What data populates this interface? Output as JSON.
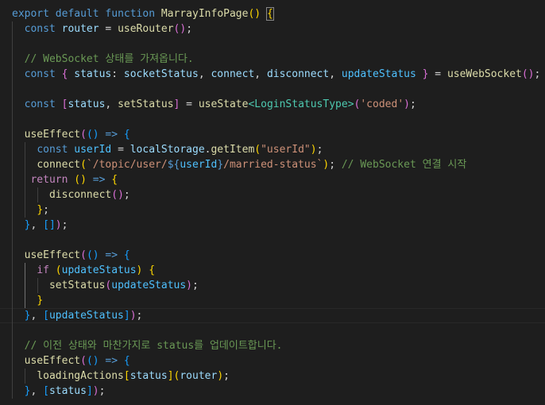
{
  "editor": {
    "language": "typescript",
    "theme_colors": {
      "background": "#1e1e1e",
      "keyword": "#569cd6",
      "control": "#c586c0",
      "function": "#dcdcaa",
      "variable": "#9cdcfe",
      "string": "#ce9178",
      "type": "#4ec9b0",
      "comment": "#6a9955",
      "bracket_1": "#ffd700",
      "bracket_2": "#da70d6",
      "bracket_3": "#179fff"
    },
    "lines": [
      [
        [
          "kw",
          "export"
        ],
        [
          "p",
          " "
        ],
        [
          "kw",
          "default"
        ],
        [
          "p",
          " "
        ],
        [
          "kw",
          "function"
        ],
        [
          "p",
          " "
        ],
        [
          "fn",
          "MarrayInfoPage"
        ],
        [
          "b1",
          "()"
        ],
        [
          "p",
          " "
        ],
        [
          "b1",
          "{"
        ]
      ],
      [
        [
          "p",
          "  "
        ],
        [
          "kw",
          "const"
        ],
        [
          "p",
          " "
        ],
        [
          "var",
          "router"
        ],
        [
          "p",
          " = "
        ],
        [
          "fn",
          "useRouter"
        ],
        [
          "b2",
          "()"
        ],
        [
          "p",
          ";"
        ]
      ],
      [],
      [
        [
          "p",
          "  "
        ],
        [
          "cm",
          "// WebSocket 상태를 가져옵니다."
        ]
      ],
      [
        [
          "p",
          "  "
        ],
        [
          "kw",
          "const"
        ],
        [
          "p",
          " "
        ],
        [
          "b2",
          "{"
        ],
        [
          "p",
          " "
        ],
        [
          "var",
          "status"
        ],
        [
          "p",
          ": "
        ],
        [
          "var",
          "socketStatus"
        ],
        [
          "p",
          ", "
        ],
        [
          "var",
          "connect"
        ],
        [
          "p",
          ", "
        ],
        [
          "var",
          "disconnect"
        ],
        [
          "p",
          ", "
        ],
        [
          "const",
          "updateStatus"
        ],
        [
          "p",
          " "
        ],
        [
          "b2",
          "}"
        ],
        [
          "p",
          " = "
        ],
        [
          "fn",
          "useWebSocket"
        ],
        [
          "b2",
          "()"
        ],
        [
          "p",
          ";"
        ]
      ],
      [],
      [
        [
          "p",
          "  "
        ],
        [
          "kw",
          "const"
        ],
        [
          "p",
          " "
        ],
        [
          "b2",
          "["
        ],
        [
          "var",
          "status"
        ],
        [
          "p",
          ", "
        ],
        [
          "fn",
          "setStatus"
        ],
        [
          "b2",
          "]"
        ],
        [
          "p",
          " = "
        ],
        [
          "fn",
          "useState"
        ],
        [
          "type",
          "<LoginStatusType>"
        ],
        [
          "b2",
          "("
        ],
        [
          "str",
          "'coded'"
        ],
        [
          "b2",
          ")"
        ],
        [
          "p",
          ";"
        ]
      ],
      [],
      [
        [
          "p",
          "  "
        ],
        [
          "fn",
          "useEffect"
        ],
        [
          "b2",
          "("
        ],
        [
          "b3",
          "()"
        ],
        [
          "p",
          " "
        ],
        [
          "kw",
          "=>"
        ],
        [
          "p",
          " "
        ],
        [
          "b3",
          "{"
        ]
      ],
      [
        [
          "p",
          "    "
        ],
        [
          "kw",
          "const"
        ],
        [
          "p",
          " "
        ],
        [
          "const",
          "userId"
        ],
        [
          "p",
          " = "
        ],
        [
          "var",
          "localStorage"
        ],
        [
          "p",
          "."
        ],
        [
          "fn",
          "getItem"
        ],
        [
          "b1",
          "("
        ],
        [
          "str",
          "\"userId\""
        ],
        [
          "b1",
          ")"
        ],
        [
          "p",
          ";"
        ]
      ],
      [
        [
          "p",
          "    "
        ],
        [
          "fn",
          "connect"
        ],
        [
          "b1",
          "("
        ],
        [
          "str",
          "`/topic/user/"
        ],
        [
          "kw",
          "${"
        ],
        [
          "const",
          "userId"
        ],
        [
          "kw",
          "}"
        ],
        [
          "str",
          "/married-status`"
        ],
        [
          "b1",
          ")"
        ],
        [
          "p",
          "; "
        ],
        [
          "cm",
          "// WebSocket 연결 시작"
        ]
      ],
      [
        [
          "p",
          "   "
        ],
        [
          "ctl",
          "return"
        ],
        [
          "p",
          " "
        ],
        [
          "b1",
          "()"
        ],
        [
          "p",
          " "
        ],
        [
          "kw",
          "=>"
        ],
        [
          "p",
          " "
        ],
        [
          "b1",
          "{"
        ]
      ],
      [
        [
          "p",
          "      "
        ],
        [
          "fn",
          "disconnect"
        ],
        [
          "b2",
          "()"
        ],
        [
          "p",
          ";"
        ]
      ],
      [
        [
          "p",
          "    "
        ],
        [
          "b1",
          "}"
        ],
        [
          "p",
          ";"
        ]
      ],
      [
        [
          "p",
          "  "
        ],
        [
          "b3",
          "}"
        ],
        [
          "p",
          ", "
        ],
        [
          "b3",
          "[]"
        ],
        [
          "b2",
          ")"
        ],
        [
          "p",
          ";"
        ]
      ],
      [],
      [
        [
          "p",
          "  "
        ],
        [
          "fn",
          "useEffect"
        ],
        [
          "b2",
          "("
        ],
        [
          "b3",
          "()"
        ],
        [
          "p",
          " "
        ],
        [
          "kw",
          "=>"
        ],
        [
          "p",
          " "
        ],
        [
          "b3",
          "{"
        ]
      ],
      [
        [
          "p",
          "    "
        ],
        [
          "ctl",
          "if"
        ],
        [
          "p",
          " "
        ],
        [
          "b1",
          "("
        ],
        [
          "const",
          "updateStatus"
        ],
        [
          "b1",
          ")"
        ],
        [
          "p",
          " "
        ],
        [
          "b1",
          "{"
        ]
      ],
      [
        [
          "p",
          "      "
        ],
        [
          "fn",
          "setStatus"
        ],
        [
          "b2",
          "("
        ],
        [
          "const",
          "updateStatus"
        ],
        [
          "b2",
          ")"
        ],
        [
          "p",
          ";"
        ]
      ],
      [
        [
          "p",
          "    "
        ],
        [
          "b1",
          "}"
        ]
      ],
      [
        [
          "p",
          "  "
        ],
        [
          "b3",
          "}"
        ],
        [
          "p",
          ", "
        ],
        [
          "b3",
          "["
        ],
        [
          "const",
          "updateStatus"
        ],
        [
          "b3",
          "]"
        ],
        [
          "b2",
          ")"
        ],
        [
          "p",
          ";"
        ]
      ],
      [],
      [
        [
          "p",
          "  "
        ],
        [
          "cm",
          "// 이전 상태와 마찬가지로 status를 업데이트합니다."
        ]
      ],
      [
        [
          "p",
          "  "
        ],
        [
          "fn",
          "useEffect"
        ],
        [
          "b2",
          "("
        ],
        [
          "b3",
          "()"
        ],
        [
          "p",
          " "
        ],
        [
          "kw",
          "=>"
        ],
        [
          "p",
          " "
        ],
        [
          "b3",
          "{"
        ]
      ],
      [
        [
          "p",
          "    "
        ],
        [
          "fn",
          "loadingActions"
        ],
        [
          "b1",
          "["
        ],
        [
          "var",
          "status"
        ],
        [
          "b1",
          "]"
        ],
        [
          "b1",
          "("
        ],
        [
          "var",
          "router"
        ],
        [
          "b1",
          ")"
        ],
        [
          "p",
          ";"
        ]
      ],
      [
        [
          "p",
          "  "
        ],
        [
          "b3",
          "}"
        ],
        [
          "p",
          ", "
        ],
        [
          "b3",
          "["
        ],
        [
          "var",
          "status"
        ],
        [
          "b3",
          "]"
        ],
        [
          "b2",
          ")"
        ],
        [
          "p",
          ";"
        ]
      ]
    ]
  }
}
